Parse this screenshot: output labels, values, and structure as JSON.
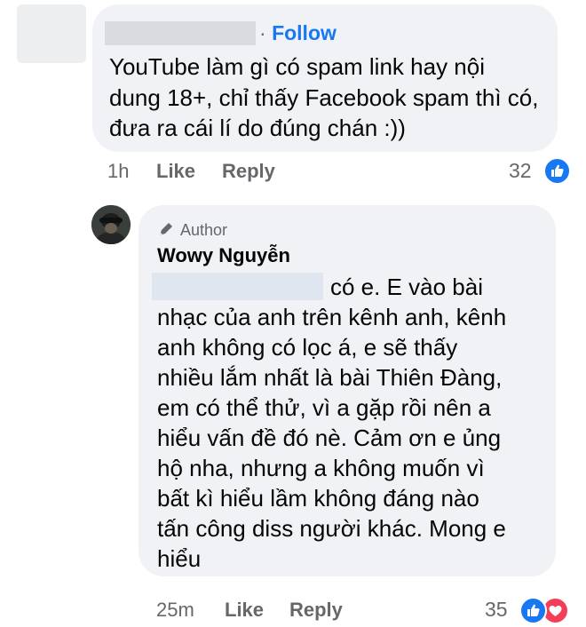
{
  "comment1": {
    "follow_label": "Follow",
    "separator": "·",
    "text": "YouTube làm gì có spam link hay nội dung 18+, chỉ thấy Facebook spam thì có, đưa ra cái lí do đúng chán :))",
    "time": "1h",
    "like_label": "Like",
    "reply_label": "Reply",
    "reaction_count": "32"
  },
  "comment2": {
    "badge_label": "Author",
    "author_name": "Wowy Nguyễn",
    "lines": [
      "có e. E vào bài",
      "nhạc của anh trên kênh anh, kênh",
      "anh không có lọc á, e sẽ thấy",
      "nhiều lắm nhất là bài Thiên Đàng,",
      "em có thể thử, vì a gặp rồi nên a",
      "hiểu vấn đề đó nè. Cảm ơn e ủng",
      "hộ nha, nhưng a không muốn vì",
      "bất kì hiểu lầm không đáng nào",
      "tấn công diss người khác. Mong e",
      "hiểu"
    ],
    "time": "25m",
    "like_label": "Like",
    "reply_label": "Reply",
    "reaction_count": "35"
  },
  "colors": {
    "link_blue": "#1877f2",
    "bubble_bg": "#f0f2f5",
    "meta_gray": "#65676b",
    "love_red": "#f33e58"
  },
  "icons": [
    "pen-icon",
    "thumbs-up-icon",
    "heart-icon"
  ]
}
